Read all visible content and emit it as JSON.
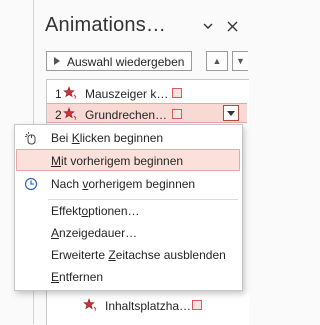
{
  "pane": {
    "title": "Animations…",
    "play_label": "Auswahl wiedergeben",
    "dropdown_icon": "chevron-down-icon",
    "close_icon": "close-icon"
  },
  "list": {
    "items": [
      {
        "num": "1",
        "name": "Mauszeiger k…"
      },
      {
        "num": "2",
        "name": "Grundrechen…"
      },
      {
        "num": "",
        "name": "Inhaltsplatzha…"
      }
    ]
  },
  "menu": {
    "items": [
      {
        "pre": "Bei ",
        "u": "K",
        "post": "licken beginnen"
      },
      {
        "pre": "",
        "u": "M",
        "post": "it vorherigem beginnen"
      },
      {
        "pre": "Nach ",
        "u": "v",
        "post": "orherigem beginnen"
      },
      {
        "pre": "Effekt",
        "u": "o",
        "post": "ptionen…"
      },
      {
        "pre": "",
        "u": "A",
        "post": "nzeigedauer…"
      },
      {
        "pre": "Erweiterte ",
        "u": "Z",
        "post": "eitachse ausblenden"
      },
      {
        "pre": "",
        "u": "E",
        "post": "ntfernen"
      }
    ]
  },
  "colors": {
    "accent": "#c43e1c",
    "selection_bg": "#f9d9d4",
    "bar_fill": "#fbe3e3",
    "bar_border": "#d9595e"
  }
}
